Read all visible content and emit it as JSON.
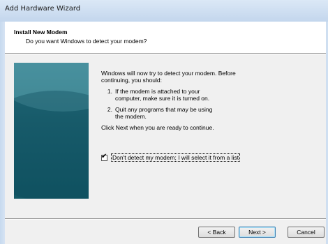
{
  "window": {
    "title": "Add Hardware Wizard"
  },
  "header": {
    "title": "Install New Modem",
    "subtitle": "Do you want Windows to detect your modem?"
  },
  "content": {
    "intro_line1": "Windows will now try to detect your modem.  Before",
    "intro_line2": "continuing, you should:",
    "steps": [
      {
        "num": "1.",
        "line1": "If the modem is attached to your",
        "line2": "computer, make sure it is turned on."
      },
      {
        "num": "2.",
        "line1": "Quit any programs that may be using",
        "line2": "the modem."
      }
    ],
    "continue_text": "Click Next when you are ready to continue.",
    "checkbox": {
      "label": "Don't detect my modem; I will select it from a list",
      "checked": true
    }
  },
  "buttons": {
    "back": "< Back",
    "next": "Next >",
    "cancel": "Cancel"
  }
}
